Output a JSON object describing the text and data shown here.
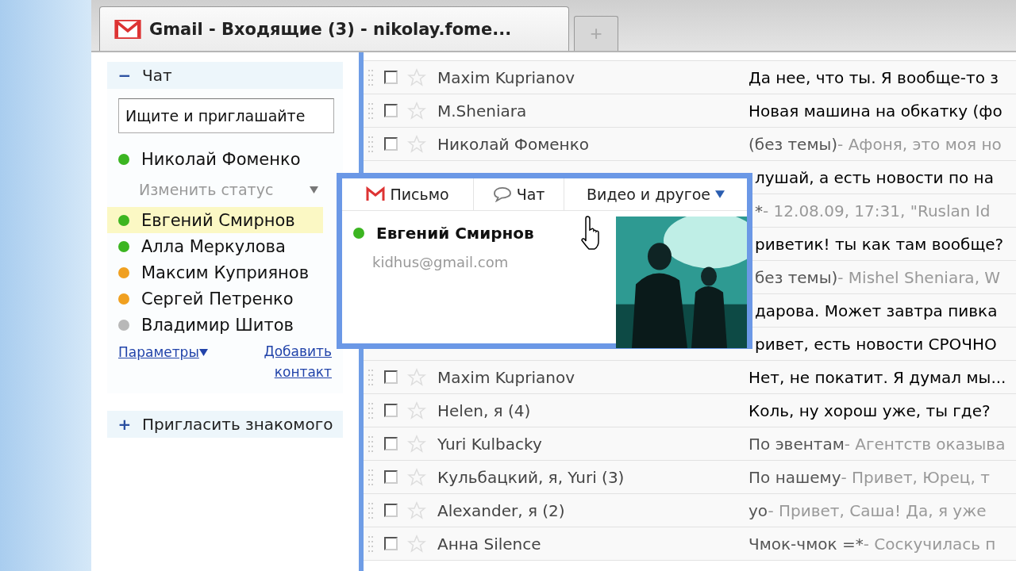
{
  "browser": {
    "tab_title": "Gmail - Входящие (3) - nikolay.fome...",
    "new_tab": "+"
  },
  "chat": {
    "toggle": "−",
    "title": "Чат",
    "search": {
      "value": "Ищите и приглашайте"
    },
    "me": {
      "name": "Николай Фоменко",
      "color": "#3cb521",
      "status_menu": "Изменить статус"
    },
    "contacts": [
      {
        "name": "Евгений Смирнов",
        "color": "#3cb521",
        "selected": true
      },
      {
        "name": "Алла Меркулова",
        "color": "#3cb521",
        "selected": false
      },
      {
        "name": "Максим Куприянов",
        "color": "#f0a020",
        "selected": false
      },
      {
        "name": "Сергей Петренко",
        "color": "#f0a020",
        "selected": false
      },
      {
        "name": "Владимир Шитов",
        "color": "#b8b8b8",
        "selected": false
      }
    ],
    "options_link": "Параметры",
    "add_link": "Добавить контакт"
  },
  "invite": {
    "toggle": "+",
    "label": "Пригласить знакомого"
  },
  "messages": [
    {
      "sender": "Maxim Kuprianov",
      "subject": "Да нее, что ты. Я вообще-то з",
      "unread": true,
      "checked": false
    },
    {
      "sender": "M.Sheniara",
      "subject": "Новая машина на обкатку (фо",
      "unread": true,
      "checked": false
    },
    {
      "sender": "Николай Фоменко",
      "subject": "(без темы)",
      "snippet": "- Афоня, это моя но",
      "unread": false,
      "checked": false
    },
    {
      "subject": "лушай, а есть новости по на",
      "unread": true
    },
    {
      "subject": "*",
      "snippet": "- 12.08.09, 17:31, \"Ruslan Id",
      "unread": false
    },
    {
      "subject": "риветик! ты как там вообще?",
      "unread": true
    },
    {
      "subject": "без темы)",
      "snippet": "- Mishel Sheniara, W",
      "unread": false
    },
    {
      "subject": "дарова. Может завтра пивка",
      "unread": true
    },
    {
      "subject": "ривет, есть новости СРОЧНО",
      "unread": true
    },
    {
      "sender": "Maxim Kuprianov",
      "subject": "Нет, не покатит. Я думал мы...",
      "unread": true,
      "checked": false
    },
    {
      "sender": "Helen, я (4)",
      "subject": "Коль, ну хорош уже, ты где?",
      "unread": true,
      "checked": false
    },
    {
      "sender": "Yuri Kulbacky",
      "subject": "По эвентам",
      "snippet": "- Агентств оказыва",
      "unread": false,
      "checked": false
    },
    {
      "sender": "Кульбацкий, я, Yuri (3)",
      "subject": "По нашему",
      "snippet": "- Привет, Юрец, т",
      "unread": false,
      "checked": false
    },
    {
      "sender": "Alexander, я (2)",
      "subject": "yo",
      "snippet": "- Привет, Саша! Да, я уже",
      "unread": false,
      "checked": false
    },
    {
      "sender": "Анна Silence",
      "subject": "Чмок-чмок =*",
      "snippet": "- Соскучилась п",
      "unread": false,
      "checked": false
    }
  ],
  "contact_card": {
    "tabs": [
      {
        "label": "Письмо",
        "kind": "mail",
        "selected": false
      },
      {
        "label": "Чат",
        "kind": "chat",
        "selected": false
      },
      {
        "label": "Видео и другое",
        "kind": "more",
        "selected": false
      }
    ],
    "name": "Евгений Смирнов",
    "color": "#3cb521",
    "email": "kidhus@gmail.com"
  }
}
